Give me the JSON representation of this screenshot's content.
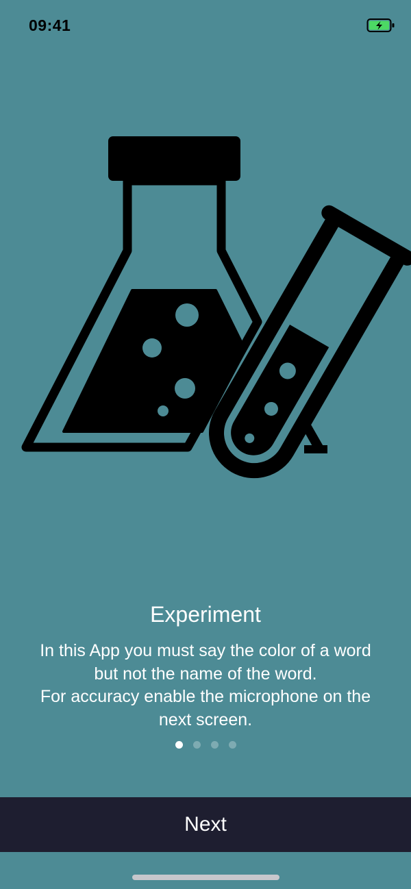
{
  "status_bar": {
    "time": "09:41",
    "battery_icon": "battery-charging-icon",
    "battery_color": "#4cd964"
  },
  "illustration": {
    "icon": "lab-flask-test-tube-icon"
  },
  "onboarding": {
    "title": "Experiment",
    "description_lines": [
      "In this App you must say the color of a word",
      "but not the name of the word.",
      "For accuracy enable the microphone on the",
      "next screen."
    ],
    "page_count": 4,
    "current_page": 1
  },
  "footer": {
    "next_label": "Next"
  },
  "colors": {
    "background": "#4d8b95",
    "button_background": "#1e1e30",
    "text": "#ffffff"
  }
}
